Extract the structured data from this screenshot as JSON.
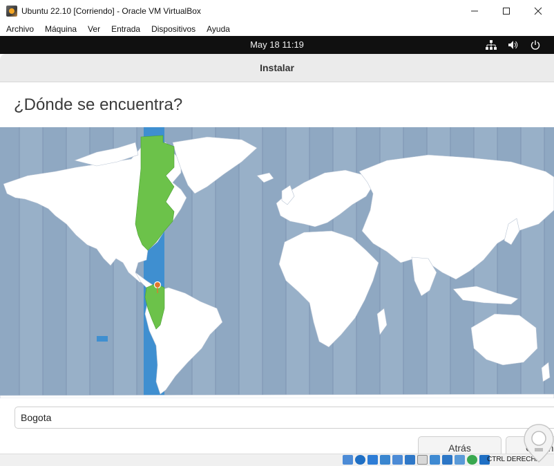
{
  "host_window": {
    "title": "Ubuntu 22.10 [Corriendo] - Oracle VM VirtualBox",
    "controls": [
      "minimize-icon",
      "maximize-icon",
      "close-icon"
    ]
  },
  "menubar": {
    "items": [
      "Archivo",
      "Máquina",
      "Ver",
      "Entrada",
      "Dispositivos",
      "Ayuda"
    ]
  },
  "topbar": {
    "clock": "May 18  11:19",
    "tray_icons": [
      "network-icon",
      "volume-icon",
      "power-icon"
    ]
  },
  "installer": {
    "header_title": "Instalar",
    "page_title": "¿Dónde se encuentra?",
    "timezone_map": {
      "selected_zone_label": "Bogota",
      "highlight_color": "#6cc24a",
      "zone_band_color": "#3f8fd0",
      "ocean_color": "#8fa8c2",
      "pin_color": "#e0762d"
    },
    "location_value": "Bogota",
    "back_label": "Atrás",
    "next_label": "Contin"
  },
  "statusbar": {
    "hostkey_label": "CTRL DERECHA"
  }
}
